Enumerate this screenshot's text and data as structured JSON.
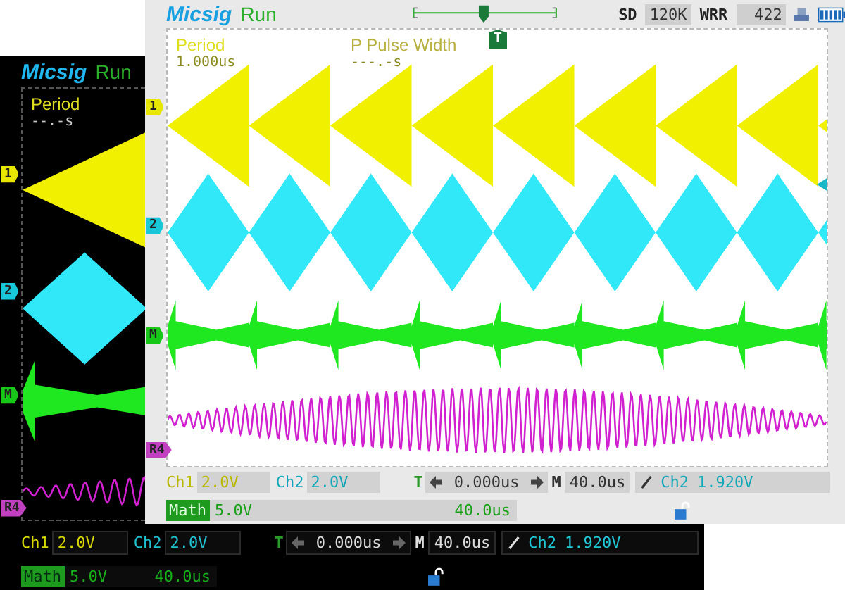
{
  "screens": [
    {
      "kind": "dark",
      "brand": "Micsig",
      "status": "Run",
      "measurements": [
        {
          "label": "Period",
          "value": "--.-s",
          "dim": false
        }
      ],
      "channel_markers": [
        {
          "label": "1",
          "color": "#e6e600"
        },
        {
          "label": "2",
          "color": "#18c8d8"
        },
        {
          "label": "M",
          "color": "#18c818"
        },
        {
          "label": "R4",
          "color": "#c040c0"
        }
      ],
      "bottom_bar": {
        "channels": [
          {
            "label": "Ch1",
            "value": "2.0V",
            "color": "#d8d800"
          },
          {
            "label": "Ch2",
            "value": "2.0V",
            "color": "#20c0d0"
          }
        ],
        "trigger": {
          "label": "T",
          "position": "0.000us"
        },
        "timebase": {
          "label": "M",
          "value": "40.0us"
        },
        "trigger_level": {
          "source": "Ch2",
          "value": "1.920V"
        }
      },
      "math": {
        "label": "Math",
        "scale": "5.0V",
        "timebase": "40.0us"
      }
    },
    {
      "kind": "light",
      "brand": "Micsig",
      "status": "Run",
      "trigger_marker": "T",
      "sample": {
        "mode": "SD",
        "depth": "120K",
        "rate_label": "WRR",
        "rate": "422"
      },
      "measurements": [
        {
          "label": "Period",
          "value": "1.000us",
          "dim": false
        },
        {
          "label": "P Pulse Width",
          "value": "---.-s",
          "dim": true
        }
      ],
      "channel_markers": [
        {
          "label": "1",
          "color": "#e6e600"
        },
        {
          "label": "2",
          "color": "#18c8d8"
        },
        {
          "label": "M",
          "color": "#18c818"
        },
        {
          "label": "R4",
          "color": "#c040c0"
        }
      ],
      "bottom_bar": {
        "channels": [
          {
            "label": "Ch1",
            "value": "2.0V",
            "color": "#b8b800"
          },
          {
            "label": "Ch2",
            "value": "2.0V",
            "color": "#10a8b8"
          }
        ],
        "trigger": {
          "label": "T",
          "position": "0.000us"
        },
        "timebase": {
          "label": "M",
          "value": "40.0us"
        },
        "trigger_level": {
          "source": "Ch2",
          "value": "1.920V"
        }
      },
      "math": {
        "label": "Math",
        "scale": "5.0V",
        "timebase": "40.0us"
      }
    }
  ]
}
